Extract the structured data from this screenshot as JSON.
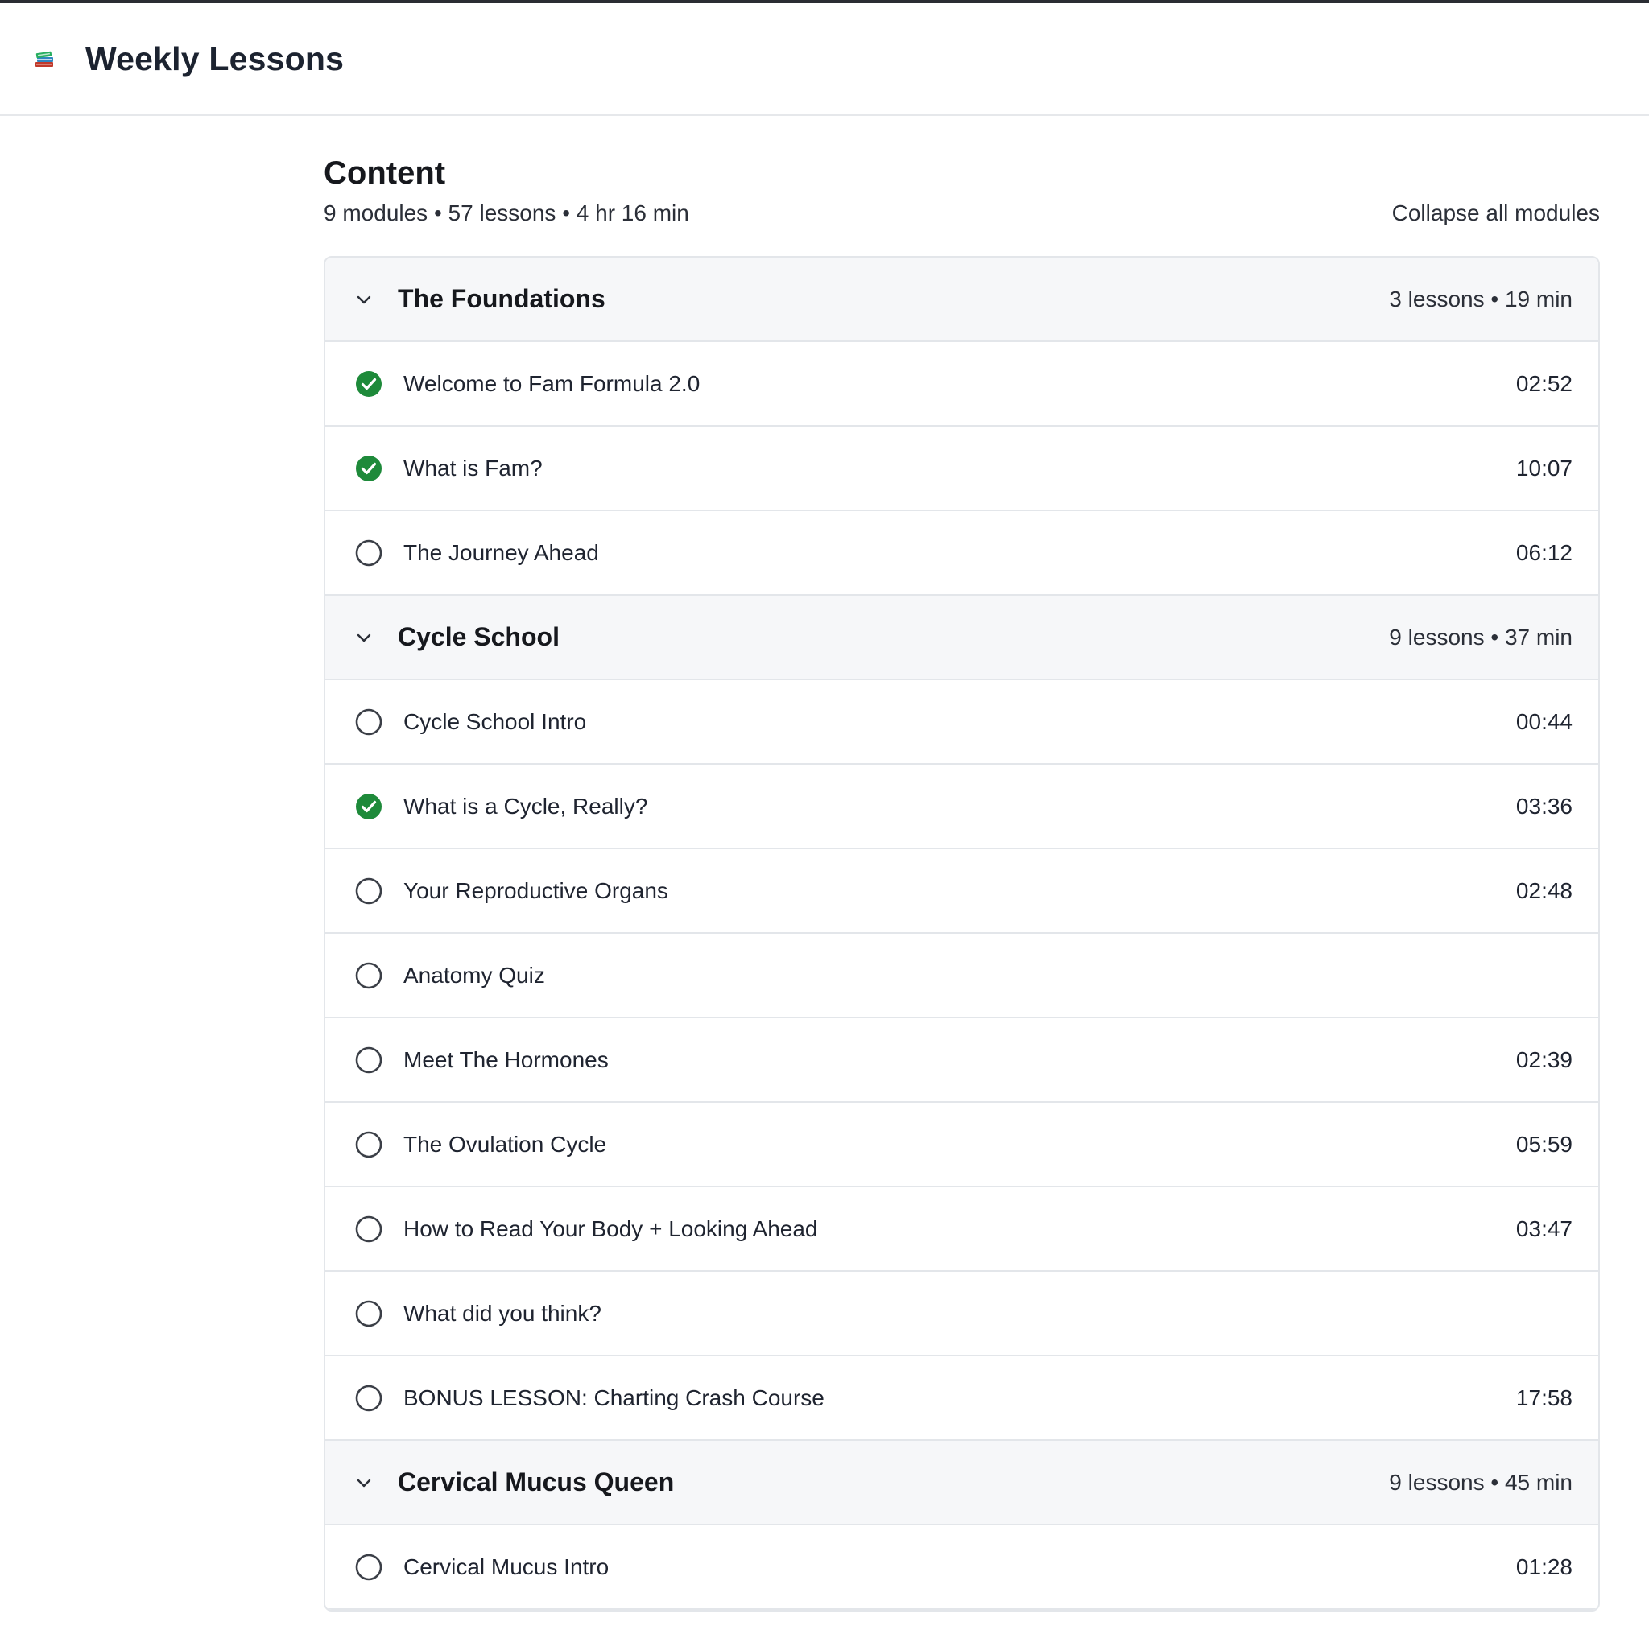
{
  "header": {
    "app_title": "Weekly Lessons",
    "icon": "books-icon"
  },
  "content": {
    "title": "Content",
    "summary": "9 modules • 57 lessons • 4 hr 16 min",
    "collapse_label": "Collapse all modules"
  },
  "colors": {
    "complete": "#1e8a3a",
    "incomplete_ring": "#3b3f47",
    "module_bg": "#f6f7f9",
    "border": "#e3e6ea"
  },
  "modules": [
    {
      "title": "The Foundations",
      "meta": "3 lessons • 19 min",
      "lessons": [
        {
          "title": "Welcome to Fam Formula 2.0",
          "duration": "02:52",
          "completed": true
        },
        {
          "title": "What is Fam?",
          "duration": "10:07",
          "completed": true
        },
        {
          "title": "The Journey Ahead",
          "duration": "06:12",
          "completed": false
        }
      ]
    },
    {
      "title": "Cycle School",
      "meta": "9 lessons • 37 min",
      "lessons": [
        {
          "title": "Cycle School Intro",
          "duration": "00:44",
          "completed": false
        },
        {
          "title": "What is a Cycle, Really?",
          "duration": "03:36",
          "completed": true
        },
        {
          "title": "Your Reproductive Organs",
          "duration": "02:48",
          "completed": false
        },
        {
          "title": "Anatomy Quiz",
          "duration": "",
          "completed": false
        },
        {
          "title": "Meet The Hormones",
          "duration": "02:39",
          "completed": false
        },
        {
          "title": "The Ovulation Cycle",
          "duration": "05:59",
          "completed": false
        },
        {
          "title": "How to Read Your Body + Looking Ahead",
          "duration": "03:47",
          "completed": false
        },
        {
          "title": "What did you think?",
          "duration": "",
          "completed": false
        },
        {
          "title": "BONUS LESSON: Charting Crash Course",
          "duration": "17:58",
          "completed": false
        }
      ]
    },
    {
      "title": "Cervical Mucus Queen",
      "meta": "9 lessons • 45 min",
      "lessons": [
        {
          "title": "Cervical Mucus Intro",
          "duration": "01:28",
          "completed": false
        }
      ]
    }
  ]
}
